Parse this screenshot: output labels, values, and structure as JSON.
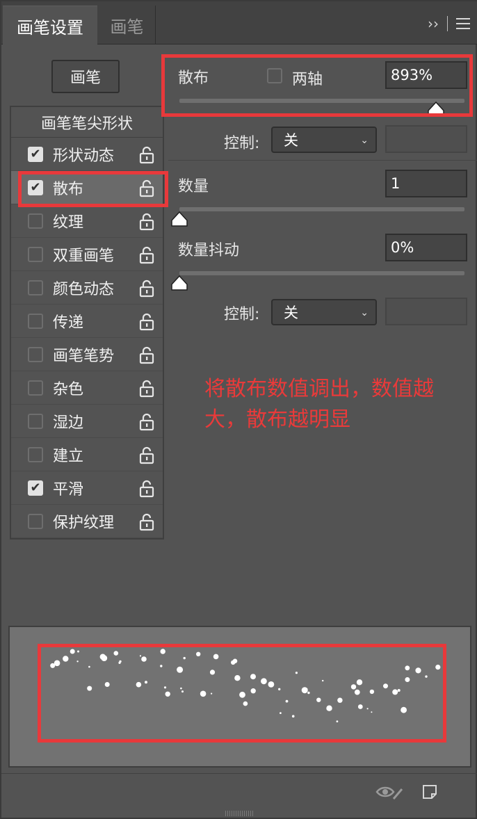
{
  "header": {
    "tab_active": "画笔设置",
    "tab_inactive": "画笔",
    "expand_icon": "››"
  },
  "left": {
    "brush_button": "画笔",
    "tip_shape_label": "画笔笔尖形状",
    "options": [
      {
        "label": "形状动态",
        "checked": true
      },
      {
        "label": "散布",
        "checked": true,
        "selected": true
      },
      {
        "label": "纹理",
        "checked": false
      },
      {
        "label": "双重画笔",
        "checked": false
      },
      {
        "label": "颜色动态",
        "checked": false
      },
      {
        "label": "传递",
        "checked": false
      },
      {
        "label": "画笔笔势",
        "checked": false
      },
      {
        "label": "杂色",
        "checked": false
      },
      {
        "label": "湿边",
        "checked": false
      },
      {
        "label": "建立",
        "checked": false
      },
      {
        "label": "平滑",
        "checked": true
      },
      {
        "label": "保护纹理",
        "checked": false
      }
    ]
  },
  "right": {
    "scatter_label": "散布",
    "both_axes_label": "两轴",
    "scatter_value": "893%",
    "scatter_level": 0.9,
    "control_label_1": "控制:",
    "control_value_1": "关",
    "count_label": "数量",
    "count_value": "1",
    "count_level": 0.0,
    "count_jitter_label": "数量抖动",
    "count_jitter_value": "0%",
    "count_jitter_level": 0.0,
    "control_label_2": "控制:",
    "control_value_2": "关"
  },
  "annotation": {
    "line1": "将散布数值调出，数值越",
    "line2": "大，散布越明显"
  },
  "colors": {
    "annotation_red": "#e8393b",
    "panel_bg": "#535353",
    "header_bg": "#424242"
  },
  "icons": [
    "expand-icon",
    "panel-menu-icon",
    "lock-icon",
    "checkbox-icon",
    "chevron-down-icon",
    "eye-brush-icon",
    "new-preset-icon"
  ]
}
